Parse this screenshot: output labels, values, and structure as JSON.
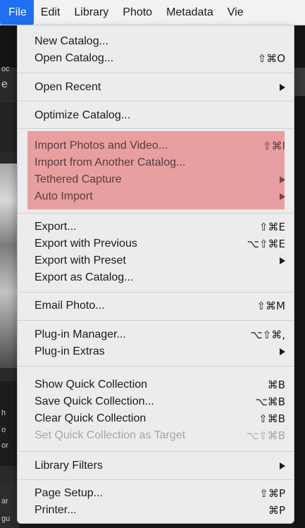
{
  "menubar": {
    "items": [
      {
        "label": "File",
        "active": true
      },
      {
        "label": "Edit",
        "active": false
      },
      {
        "label": "Library",
        "active": false
      },
      {
        "label": "Photo",
        "active": false
      },
      {
        "label": "Metadata",
        "active": false
      },
      {
        "label": "Vie",
        "active": false
      }
    ]
  },
  "background": {
    "left_text_fragments": [
      "oc",
      "e",
      "h",
      "o",
      "or",
      "ar",
      "gu"
    ]
  },
  "file_menu": {
    "groups": [
      {
        "items": [
          {
            "label": "New Catalog...",
            "shortcut": ""
          },
          {
            "label": "Open Catalog...",
            "shortcut": "⇧⌘O"
          }
        ]
      },
      {
        "items": [
          {
            "label": "Open Recent",
            "submenu": true
          }
        ]
      },
      {
        "items": [
          {
            "label": "Optimize Catalog...",
            "shortcut": ""
          }
        ]
      },
      {
        "highlighted": true,
        "highlight_color": "#e66060",
        "items": [
          {
            "label": "Import Photos and Video...",
            "shortcut": "⇧⌘I"
          },
          {
            "label": "Import from Another Catalog...",
            "shortcut": ""
          },
          {
            "label": "Tethered Capture",
            "submenu": true
          },
          {
            "label": "Auto Import",
            "submenu": true
          }
        ]
      },
      {
        "items": [
          {
            "label": "Export...",
            "shortcut": "⇧⌘E"
          },
          {
            "label": "Export with Previous",
            "shortcut": "⌥⇧⌘E"
          },
          {
            "label": "Export with Preset",
            "submenu": true
          },
          {
            "label": "Export as Catalog...",
            "shortcut": ""
          }
        ]
      },
      {
        "items": [
          {
            "label": "Email Photo...",
            "shortcut": "⇧⌘M"
          }
        ]
      },
      {
        "items": [
          {
            "label": "Plug-in Manager...",
            "shortcut": "⌥⇧⌘,"
          },
          {
            "label": "Plug-in Extras",
            "submenu": true
          }
        ]
      },
      {
        "items": [
          {
            "label": "Show Quick Collection",
            "shortcut": "⌘B"
          },
          {
            "label": "Save Quick Collection...",
            "shortcut": "⌥⌘B"
          },
          {
            "label": "Clear Quick Collection",
            "shortcut": "⇧⌘B"
          },
          {
            "label": "Set Quick Collection as Target",
            "shortcut": "⌥⇧⌘B",
            "disabled": true
          }
        ]
      },
      {
        "items": [
          {
            "label": "Library Filters",
            "submenu": true
          }
        ]
      },
      {
        "items": [
          {
            "label": "Page Setup...",
            "shortcut": "⇧⌘P"
          },
          {
            "label": "Printer...",
            "shortcut": "⌘P"
          }
        ]
      }
    ]
  },
  "colors": {
    "menubar_active": "#1e6ff2",
    "menu_background": "#ececec",
    "highlight": "#e66060",
    "disabled_text": "#a6a6a6"
  }
}
